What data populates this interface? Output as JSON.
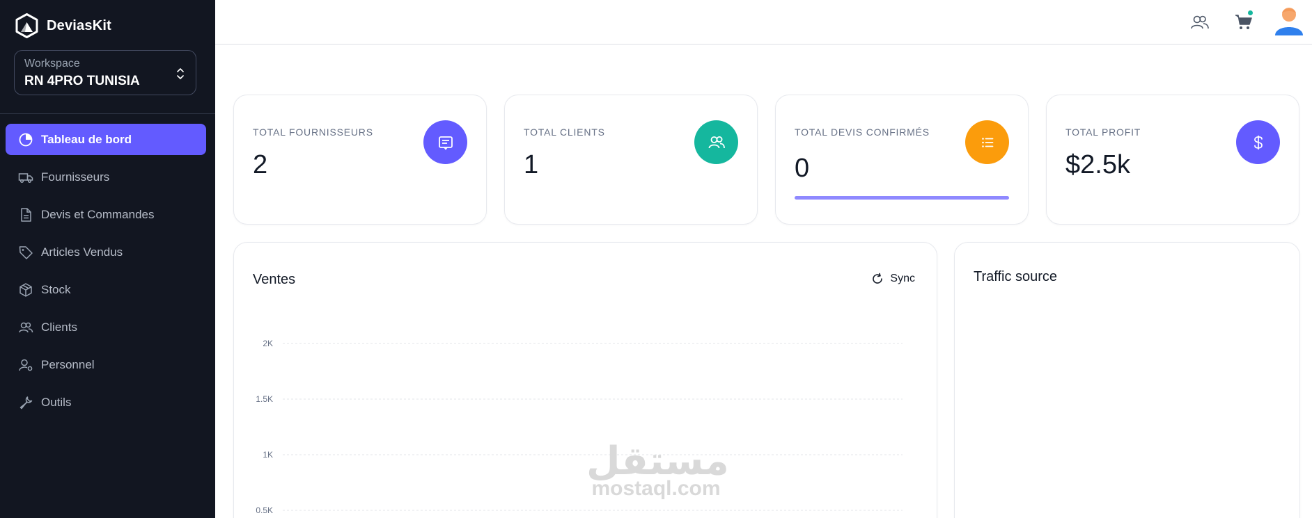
{
  "brand": {
    "name": "DeviasKit"
  },
  "workspace": {
    "label": "Workspace",
    "value": "RN 4PRO TUNISIA"
  },
  "nav": [
    {
      "label": "Tableau de bord",
      "icon": "chart-pie-icon",
      "active": true
    },
    {
      "label": "Fournisseurs",
      "icon": "truck-icon",
      "active": false
    },
    {
      "label": "Devis et Commandes",
      "icon": "document-icon",
      "active": false
    },
    {
      "label": "Articles Vendus",
      "icon": "tag-icon",
      "active": false
    },
    {
      "label": "Stock",
      "icon": "cube-icon",
      "active": false
    },
    {
      "label": "Clients",
      "icon": "users-icon",
      "active": false
    },
    {
      "label": "Personnel",
      "icon": "user-gear-icon",
      "active": false
    },
    {
      "label": "Outils",
      "icon": "wrench-icon",
      "active": false
    }
  ],
  "topbar": {
    "icons": [
      "users-icon",
      "cart-icon",
      "avatar"
    ]
  },
  "stats": [
    {
      "title": "TOTAL FOURNISSEURS",
      "value": "2",
      "icon": "receipt-icon",
      "color": "#635bff"
    },
    {
      "title": "TOTAL CLIENTS",
      "value": "1",
      "icon": "users-icon",
      "color": "#15b79e"
    },
    {
      "title": "TOTAL DEVIS CONFIRMÉS",
      "value": "0",
      "icon": "list-icon",
      "color": "#fb9c0c",
      "progress": 1.0
    },
    {
      "title": "TOTAL PROFIT",
      "value": "$2.5k",
      "icon": "dollar-icon",
      "color": "#635bff"
    }
  ],
  "ventes": {
    "title": "Ventes",
    "sync_label": "Sync"
  },
  "traffic": {
    "title": "Traffic source"
  },
  "watermark": {
    "arabic": "مستقل",
    "latin": "mostaql.com"
  },
  "colors": {
    "sidebar": "#121621",
    "primary": "#635bff",
    "success": "#15b79e",
    "warning": "#fb9c0c"
  },
  "chart_data": {
    "type": "bar",
    "title": "Ventes",
    "ytick_labels": [
      "2K",
      "1.5K",
      "1K",
      "0.5K"
    ],
    "ylim": [
      0,
      2000
    ],
    "grid": true,
    "series": []
  }
}
